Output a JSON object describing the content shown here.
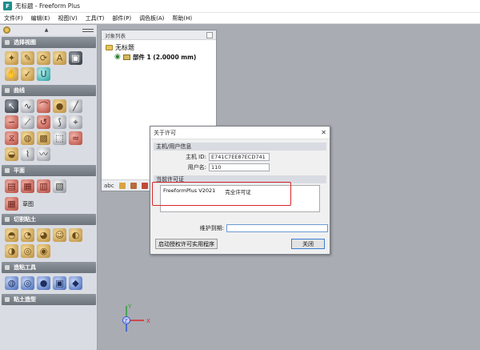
{
  "window": {
    "app_icon_letter": "F",
    "title": "无标题 - Freeform Plus"
  },
  "menu": [
    "文件(F)",
    "编辑(E)",
    "视图(V)",
    "工具(T)",
    "部件(P)",
    "调色板(A)",
    "帮助(H)"
  ],
  "toolbox": {
    "sections": [
      {
        "label": "选择视图"
      },
      {
        "label": "曲线"
      },
      {
        "label": "平面"
      },
      {
        "label": "切割粘土"
      },
      {
        "label": "造粘工具"
      },
      {
        "label": "粘土造型"
      }
    ],
    "sketch_label": "草图"
  },
  "object_panel": {
    "title": "对象列表",
    "root_label": "无标题",
    "part_label": "部件 1 (2.0000 mm)",
    "bottom_icons": [
      "abc"
    ]
  },
  "dialog": {
    "title": "关于许可",
    "close_glyph": "✕",
    "host_group": "主机/用户信息",
    "host_id_label": "主机 ID:",
    "host_id_value": "E741C7EE87ECD741",
    "username_label": "用户名:",
    "username_value": "110",
    "license_group": "当前许可证",
    "license_product": "FreeformPlus V2021",
    "license_type": "完全许可证",
    "maintenance_label": "维护到期:",
    "maintenance_value": "",
    "launch_button": "启动授权许可实用程序",
    "close_button": "关闭"
  },
  "axes": {
    "x_label": "X",
    "y_label": "Y",
    "z_label": "Z"
  },
  "colors": {
    "highlight": "#d9262a",
    "axis_x": "#d9262a",
    "axis_y": "#2e9d3a",
    "axis_z": "#2e55d4"
  }
}
